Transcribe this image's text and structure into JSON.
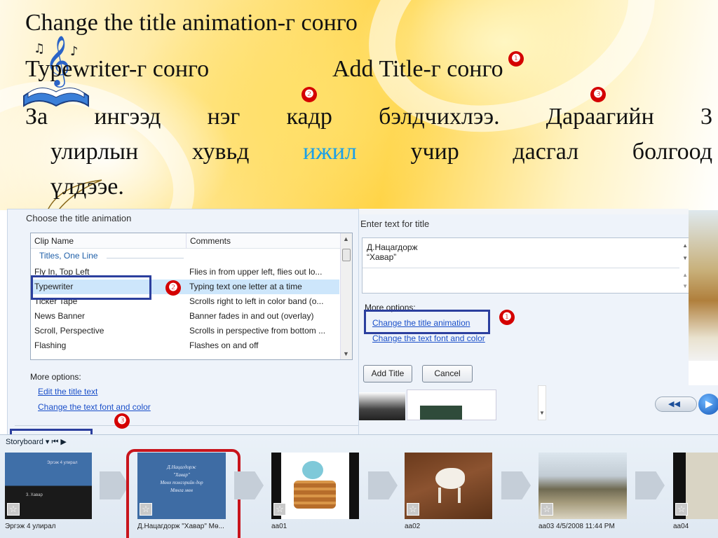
{
  "slide": {
    "line1": "Change the title animation-г сонго",
    "line2a": "Typewriter-г сонго",
    "line2b": "Add Title-г сонго",
    "para_line1": "За ингээд нэг кадр бэлдчихлээ. Дараагийн 3",
    "para_line2_pre": "улирлын хувьд ",
    "para_line2_highlight": "ижил",
    "para_line2_post": " учир дасгал болгоод",
    "para_line3": "үлдээе.",
    "markers": {
      "m1": "❶",
      "m2": "❷",
      "m3": "❸"
    }
  },
  "left_dialog": {
    "heading": "Choose the title animation",
    "columns": {
      "name": "Clip Name",
      "comments": "Comments"
    },
    "group": "Titles, One Line",
    "rows": [
      {
        "name": "Fly In, Top Left",
        "comment": "Flies in from upper left, flies out lo..."
      },
      {
        "name": "Typewriter",
        "comment": "Typing text one letter at a time"
      },
      {
        "name": "Ticker Tape",
        "comment": "Scrolls right to left in color band (o..."
      },
      {
        "name": "News Banner",
        "comment": "Banner fades in and out (overlay)"
      },
      {
        "name": "Scroll, Perspective",
        "comment": "Scrolls in perspective from bottom ..."
      },
      {
        "name": "Flashing",
        "comment": "Flashes on and off"
      }
    ],
    "more_options": "More options:",
    "link_edit": "Edit the title text",
    "link_font": "Change the text font and color"
  },
  "right_dialog": {
    "heading": "Enter text for title",
    "text_line1": "Д.Нацагдорж",
    "text_line2": "“Хавар”",
    "more_options": "More options:",
    "link_animation": "Change the title animation",
    "link_font": "Change the text font and color",
    "btn_add": "Add Title",
    "btn_cancel": "Cancel"
  },
  "storyboard": {
    "label": "Storyboard ▾  ⏮  ▶",
    "clips": [
      {
        "caption": "Эргэж 4 улирал",
        "thumb_line1": "Эргэж 4 улирал",
        "thumb_line2": "3. Хавар"
      },
      {
        "caption": "Д.Нацагдорж  \"Хавар\" Мө...",
        "thumb_lines": [
          "Д.Нацагдорж",
          "\"Хавар\"",
          "Мөнх тэнгэрийн дор",
          "Мянга мөн"
        ]
      },
      {
        "caption": "aa01"
      },
      {
        "caption": "aa02"
      },
      {
        "caption": "aa03 4/5/2008 11:44 PM"
      },
      {
        "caption": "aa04"
      }
    ]
  },
  "colors": {
    "marker_red": "#d40000",
    "link_blue": "#1a4fc9",
    "highlight_blue": "#1aa0e8",
    "annotation_box": "#2b3f9e",
    "selection": "#cde6fb"
  }
}
